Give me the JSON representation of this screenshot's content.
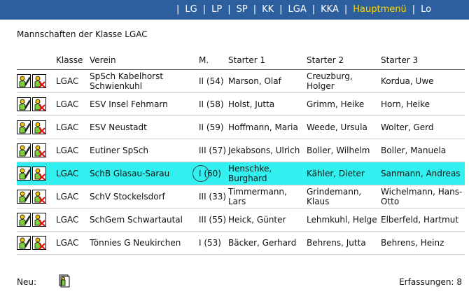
{
  "nav": {
    "items": [
      {
        "label": "LG",
        "active": false
      },
      {
        "label": "LP",
        "active": false
      },
      {
        "label": "SP",
        "active": false
      },
      {
        "label": "KK",
        "active": false
      },
      {
        "label": "LGA",
        "active": false
      },
      {
        "label": "KKA",
        "active": false
      },
      {
        "label": "Hauptmenü",
        "active": true
      },
      {
        "label": "Lo",
        "active": false
      }
    ],
    "colors": {
      "bar": "#2d5f9e",
      "text": "#ffffff",
      "active": "#ffd700"
    }
  },
  "page": {
    "title": "Mannschaften der Klasse LGAC"
  },
  "table": {
    "headers": {
      "klasse": "Klasse",
      "verein": "Verein",
      "m": "M.",
      "s1": "Starter 1",
      "s2": "Starter 2",
      "s3": "Starter 3"
    },
    "highlight_color": "#33f0f0",
    "rows": [
      {
        "klasse": "LGAC",
        "verein": "SpSch Kabelhorst Schwienkuhl",
        "m": "II (54)",
        "s1": "Marson, Olaf",
        "s2": "Creuzburg, Holger",
        "s3": "Kordua, Uwe",
        "highlight": false
      },
      {
        "klasse": "LGAC",
        "verein": "ESV Insel Fehmarn",
        "m": "II (58)",
        "s1": "Holst, Jutta",
        "s2": "Grimm, Heike",
        "s3": "Horn, Heike",
        "highlight": false
      },
      {
        "klasse": "LGAC",
        "verein": "ESV Neustadt",
        "m": "II (59)",
        "s1": "Hoffmann, Maria",
        "s2": "Weede, Ursula",
        "s3": "Wolter, Gerd",
        "highlight": false
      },
      {
        "klasse": "LGAC",
        "verein": "Eutiner SpSch",
        "m": "III (57)",
        "s1": "Jekabsons, Ulrich",
        "s2": "Boller, Wilhelm",
        "s3": "Boller, Manuela",
        "highlight": false
      },
      {
        "klasse": "LGAC",
        "verein": "SchB Glasau-Sarau",
        "m": "I (60)",
        "s1": "Henschke, Burghard",
        "s2": "Kähler, Dieter",
        "s3": "Sanmann, Andreas",
        "highlight": true
      },
      {
        "klasse": "LGAC",
        "verein": "SchV Stockelsdorf",
        "m": "III (33)",
        "s1": "Timmermann, Lars",
        "s2": "Grindemann, Klaus",
        "s3": "Wichelmann, Hans-Otto",
        "highlight": false
      },
      {
        "klasse": "LGAC",
        "verein": "SchGem Schwartautal",
        "m": "III (55)",
        "s1": "Heick, Günter",
        "s2": "Lehmkuhl, Helge",
        "s3": "Elberfeld, Hartmut",
        "highlight": false
      },
      {
        "klasse": "LGAC",
        "verein": "Tönnies G Neukirchen",
        "m": "I (53)",
        "s1": "Bäcker, Gerhard",
        "s2": "Behrens, Jutta",
        "s3": "Behrens, Heinz",
        "highlight": false
      }
    ]
  },
  "footer": {
    "new_label": "Neu:",
    "count_text": "Erfassungen: 8"
  },
  "icons": {
    "edit": "edit-person-icon",
    "delete": "delete-person-icon",
    "new": "new-document-icon"
  }
}
